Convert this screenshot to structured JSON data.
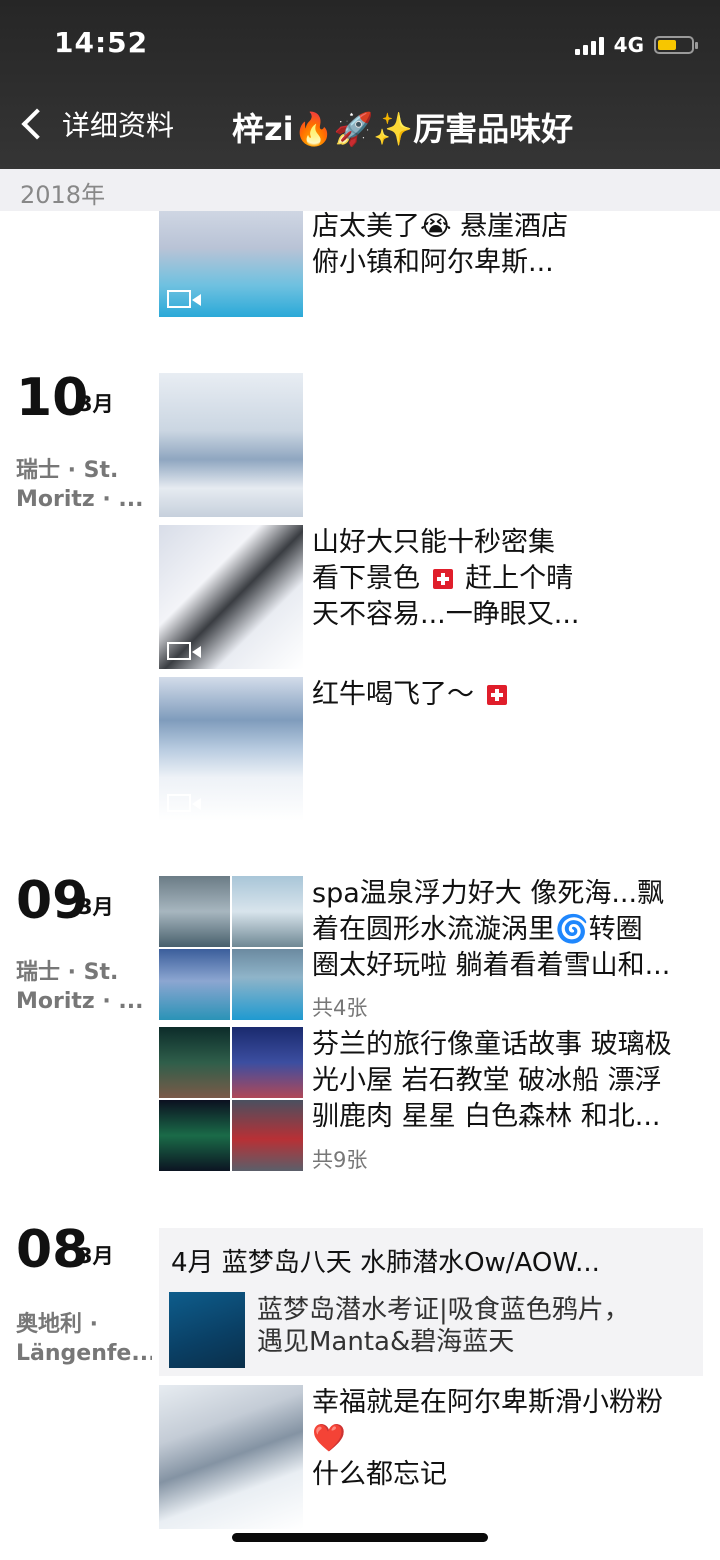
{
  "status_bar": {
    "time": "14:52",
    "network": "4G",
    "battery_level": 0.55
  },
  "nav": {
    "back_label": "详细资料",
    "title": "梓zi🔥🚀✨厉害品味好"
  },
  "year_header": "2018年",
  "entries": [
    {
      "posts": [
        {
          "text": "店太美了😭 悬崖酒店\n俯小镇和阿尔卑斯...",
          "video": true
        }
      ]
    },
    {
      "day": "10",
      "month": "3月",
      "location": "瑞士 · St.\nMoritz · ...",
      "posts": [
        {
          "text": "",
          "video": false
        },
        {
          "text": "山好大只能十秒密集\n看下景色 ",
          "text2": " 赶上个晴\n天不容易...一睁眼又...",
          "video": true
        },
        {
          "text": "红牛喝飞了～ ",
          "video": true
        }
      ]
    },
    {
      "day": "09",
      "month": "3月",
      "location": "瑞士 · St.\nMoritz · ...",
      "posts": [
        {
          "text": "spa温泉浮力好大 像死海...飘\n着在圆形水流漩涡里🌀转圈\n圈太好玩啦 躺着看着雪山和...",
          "count": "共4张"
        },
        {
          "text": "芬兰的旅行像童话故事 玻璃极\n光小屋 岩石教堂 破冰船 漂浮\n驯鹿肉 星星 白色森林 和北...",
          "count": "共9张"
        }
      ]
    },
    {
      "day": "08",
      "month": "3月",
      "location": "奥地利 ·\nLängenfe...",
      "article": {
        "title": "4月 蓝梦岛八天 水肺潜水Ow/AOW...",
        "text": "蓝梦岛潜水考证|吸食蓝色鸦片，\n遇见Manta&碧海蓝天"
      },
      "posts": [
        {
          "text": "幸福就是在阿尔卑斯滑小粉粉\n❤️\n什么都忘记",
          "video": false
        }
      ]
    }
  ]
}
